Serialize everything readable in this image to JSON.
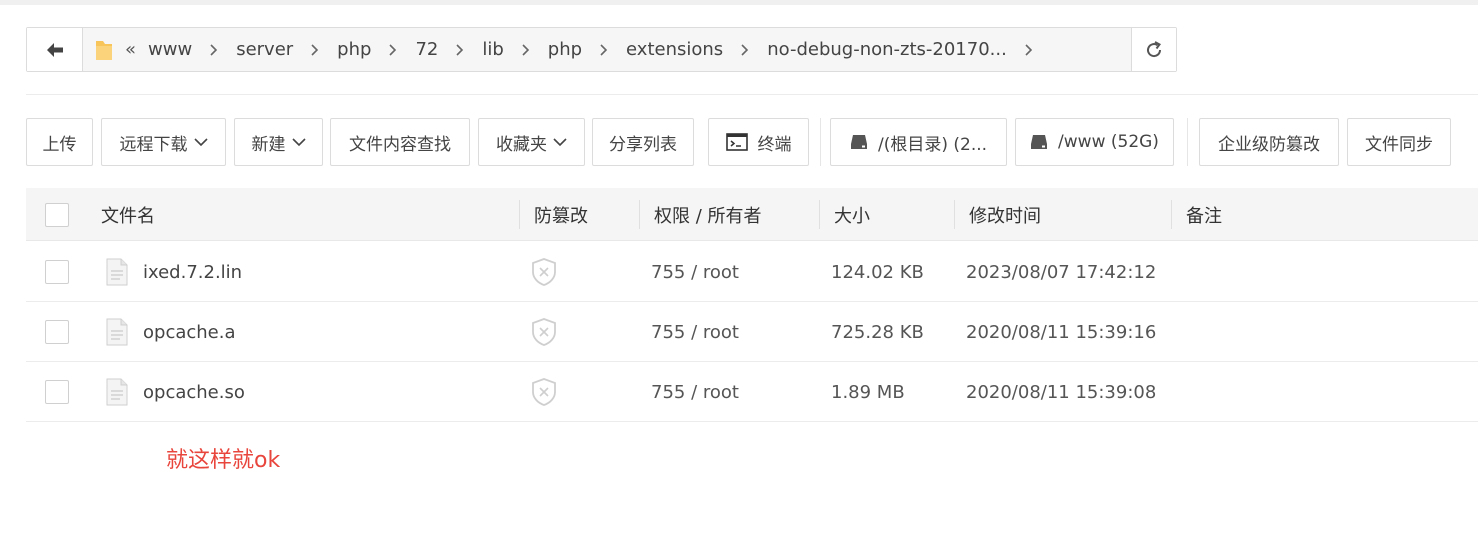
{
  "path": {
    "overflow_glyph": "«",
    "crumbs": [
      "www",
      "server",
      "php",
      "72",
      "lib",
      "php",
      "extensions",
      "no-debug-non-zts-20170..."
    ]
  },
  "toolbar": {
    "upload": "上传",
    "remote_download": "远程下载",
    "new": "新建",
    "content_search": "文件内容查找",
    "favorites": "收藏夹",
    "share_list": "分享列表",
    "terminal": "终端",
    "disk_root": "/(根目录) (2...",
    "disk_www": "/www (52G)",
    "tamper_proof": "企业级防篡改",
    "file_sync": "文件同步"
  },
  "table": {
    "headers": {
      "name": "文件名",
      "tamper": "防篡改",
      "perm": "权限 / 所有者",
      "size": "大小",
      "mtime": "修改时间",
      "note": "备注"
    },
    "rows": [
      {
        "name": "ixed.7.2.lin",
        "perm": "755 / root",
        "size": "124.02 KB",
        "mtime": "2023/08/07 17:42:12",
        "note": ""
      },
      {
        "name": "opcache.a",
        "perm": "755 / root",
        "size": "725.28 KB",
        "mtime": "2020/08/11 15:39:16",
        "note": ""
      },
      {
        "name": "opcache.so",
        "perm": "755 / root",
        "size": "1.89 MB",
        "mtime": "2020/08/11 15:39:08",
        "note": ""
      }
    ]
  },
  "annotation": "就这样就ok",
  "colors": {
    "annotation": "#e8453c",
    "folder": "#f7c55a",
    "border": "#dcdcdc",
    "header_bg": "#f5f5f5"
  },
  "icons": {
    "back": "arrow-left-icon",
    "folder": "folder-icon",
    "refresh": "refresh-icon",
    "file": "file-icon",
    "shield": "shield-off-icon",
    "terminal": "terminal-icon",
    "disk": "disk-icon",
    "chevron": "chevron-down-icon"
  }
}
